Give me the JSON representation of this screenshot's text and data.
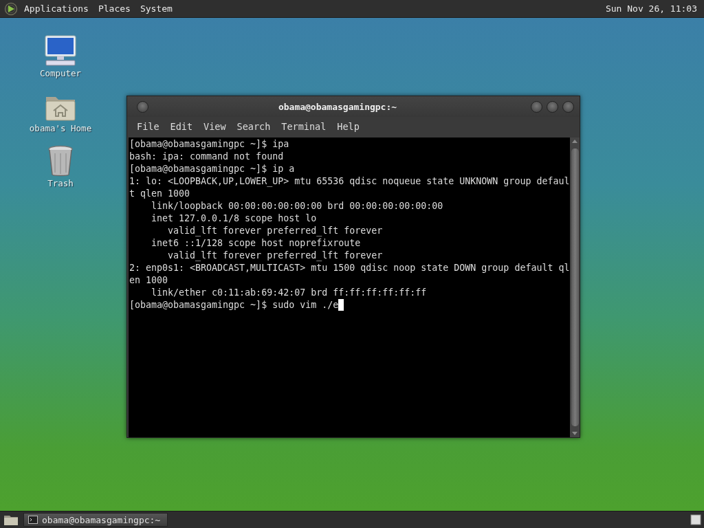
{
  "top_panel": {
    "menus": [
      "Applications",
      "Places",
      "System"
    ],
    "clock": "Sun Nov 26, 11:03"
  },
  "desktop_icons": [
    {
      "kind": "computer",
      "label": "Computer"
    },
    {
      "kind": "home",
      "label": "obama's Home"
    },
    {
      "kind": "trash",
      "label": "Trash"
    }
  ],
  "terminal": {
    "title": "obama@obamasgamingpc:~",
    "menu": [
      "File",
      "Edit",
      "View",
      "Search",
      "Terminal",
      "Help"
    ],
    "lines": [
      "[obama@obamasgamingpc ~]$ ipa",
      "bash: ipa: command not found",
      "[obama@obamasgamingpc ~]$ ip a",
      "1: lo: <LOOPBACK,UP,LOWER_UP> mtu 65536 qdisc noqueue state UNKNOWN group defaul",
      "t qlen 1000",
      "    link/loopback 00:00:00:00:00:00 brd 00:00:00:00:00:00",
      "    inet 127.0.0.1/8 scope host lo",
      "       valid_lft forever preferred_lft forever",
      "    inet6 ::1/128 scope host noprefixroute",
      "       valid_lft forever preferred_lft forever",
      "2: enp0s1: <BROADCAST,MULTICAST> mtu 1500 qdisc noop state DOWN group default ql",
      "en 1000",
      "    link/ether c0:11:ab:69:42:07 brd ff:ff:ff:ff:ff:ff",
      "[obama@obamasgamingpc ~]$ sudo vim ./e"
    ]
  },
  "taskbar": {
    "tasks": [
      {
        "label": "obama@obamasgamingpc:~",
        "selected": true
      }
    ]
  }
}
